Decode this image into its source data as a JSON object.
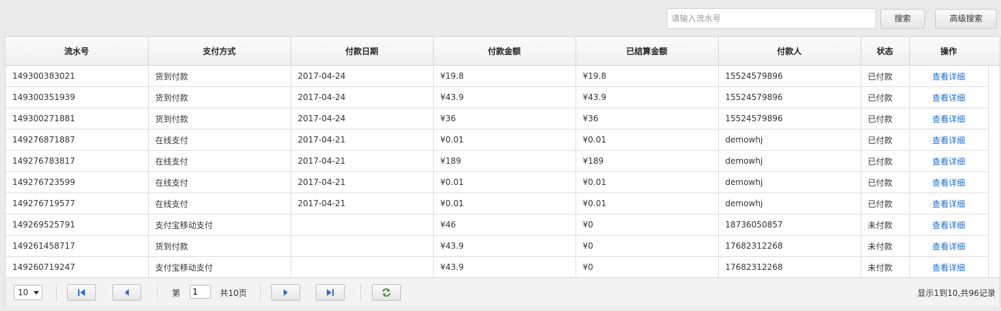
{
  "toolbar": {
    "search_placeholder": "请输入流水号",
    "search_value": "",
    "search_button": "搜索",
    "advanced_search_button": "高级搜索"
  },
  "table": {
    "columns": [
      "流水号",
      "支付方式",
      "付款日期",
      "付款金额",
      "已结算金额",
      "付款人",
      "状态",
      "操作"
    ],
    "rows": [
      {
        "serial": "149300383021",
        "method": "货到付款",
        "date": "2017-04-24",
        "amount": "¥19.8",
        "settled": "¥19.8",
        "payer": "15524579896",
        "status": "已付款",
        "action": "查看详细"
      },
      {
        "serial": "149300351939",
        "method": "货到付款",
        "date": "2017-04-24",
        "amount": "¥43.9",
        "settled": "¥43.9",
        "payer": "15524579896",
        "status": "已付款",
        "action": "查看详细"
      },
      {
        "serial": "149300271881",
        "method": "货到付款",
        "date": "2017-04-24",
        "amount": "¥36",
        "settled": "¥36",
        "payer": "15524579896",
        "status": "已付款",
        "action": "查看详细"
      },
      {
        "serial": "149276871887",
        "method": "在线支付",
        "date": "2017-04-21",
        "amount": "¥0.01",
        "settled": "¥0.01",
        "payer": "demowhj",
        "status": "已付款",
        "action": "查看详细"
      },
      {
        "serial": "149276783817",
        "method": "在线支付",
        "date": "2017-04-21",
        "amount": "¥189",
        "settled": "¥189",
        "payer": "demowhj",
        "status": "已付款",
        "action": "查看详细"
      },
      {
        "serial": "149276723599",
        "method": "在线支付",
        "date": "2017-04-21",
        "amount": "¥0.01",
        "settled": "¥0.01",
        "payer": "demowhj",
        "status": "已付款",
        "action": "查看详细"
      },
      {
        "serial": "149276719577",
        "method": "在线支付",
        "date": "2017-04-21",
        "amount": "¥0.01",
        "settled": "¥0.01",
        "payer": "demowhj",
        "status": "已付款",
        "action": "查看详细"
      },
      {
        "serial": "149269525791",
        "method": "支付宝移动支付",
        "date": "",
        "amount": "¥46",
        "settled": "¥0",
        "payer": "18736050857",
        "status": "未付款",
        "action": "查看详细"
      },
      {
        "serial": "149261458717",
        "method": "货到付款",
        "date": "",
        "amount": "¥43.9",
        "settled": "¥0",
        "payer": "17682312268",
        "status": "未付款",
        "action": "查看详细"
      },
      {
        "serial": "149260719247",
        "method": "支付宝移动支付",
        "date": "",
        "amount": "¥43.9",
        "settled": "¥0",
        "payer": "17682312268",
        "status": "未付款",
        "action": "查看详细"
      }
    ]
  },
  "pager": {
    "page_size": "10",
    "page_prefix": "第",
    "current_page": "1",
    "page_suffix": "共10页",
    "info": "显示1到10,共96记录"
  },
  "colors": {
    "link": "#1e6fd0",
    "background": "#ebebeb",
    "refresh_icon": "#3a9a2a",
    "nav_icon": "#2f6fd6"
  }
}
